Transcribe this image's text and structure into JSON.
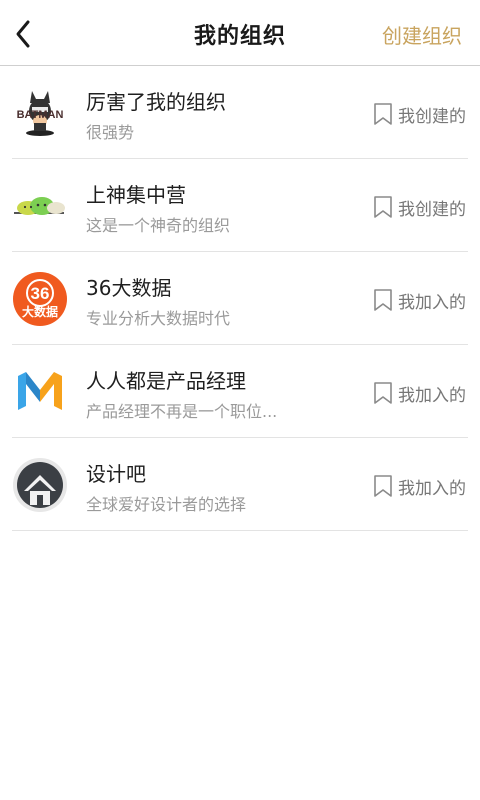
{
  "navbar": {
    "title": "我的组织",
    "action_label": "创建组织"
  },
  "organizations": [
    {
      "name": "厉害了我的组织",
      "desc": "很强势",
      "relation": "我创建的",
      "logo_icon": "batman-logo-icon",
      "logo_text": "BATMAN"
    },
    {
      "name": "上神集中营",
      "desc": "这是一个神奇的组织",
      "relation": "我创建的",
      "logo_icon": "cloud-characters-logo-icon"
    },
    {
      "name": "36大数据",
      "desc": "专业分析大数据时代",
      "relation": "我加入的",
      "logo_icon": "36-big-data-logo-icon",
      "logo_text_top": "36",
      "logo_text_bottom": "大数据"
    },
    {
      "name": "人人都是产品经理",
      "desc": "产品经理不再是一个职位...",
      "relation": "我加入的",
      "logo_icon": "m-letter-logo-icon"
    },
    {
      "name": "设计吧",
      "desc": "全球爱好设计者的选择",
      "relation": "我加入的",
      "logo_icon": "house-logo-icon"
    }
  ],
  "colors": {
    "accent_gold": "#c9a45f",
    "logo_orange": "#f05a1f",
    "m_blue": "#3aa5e8",
    "m_orange": "#f7a21b"
  }
}
